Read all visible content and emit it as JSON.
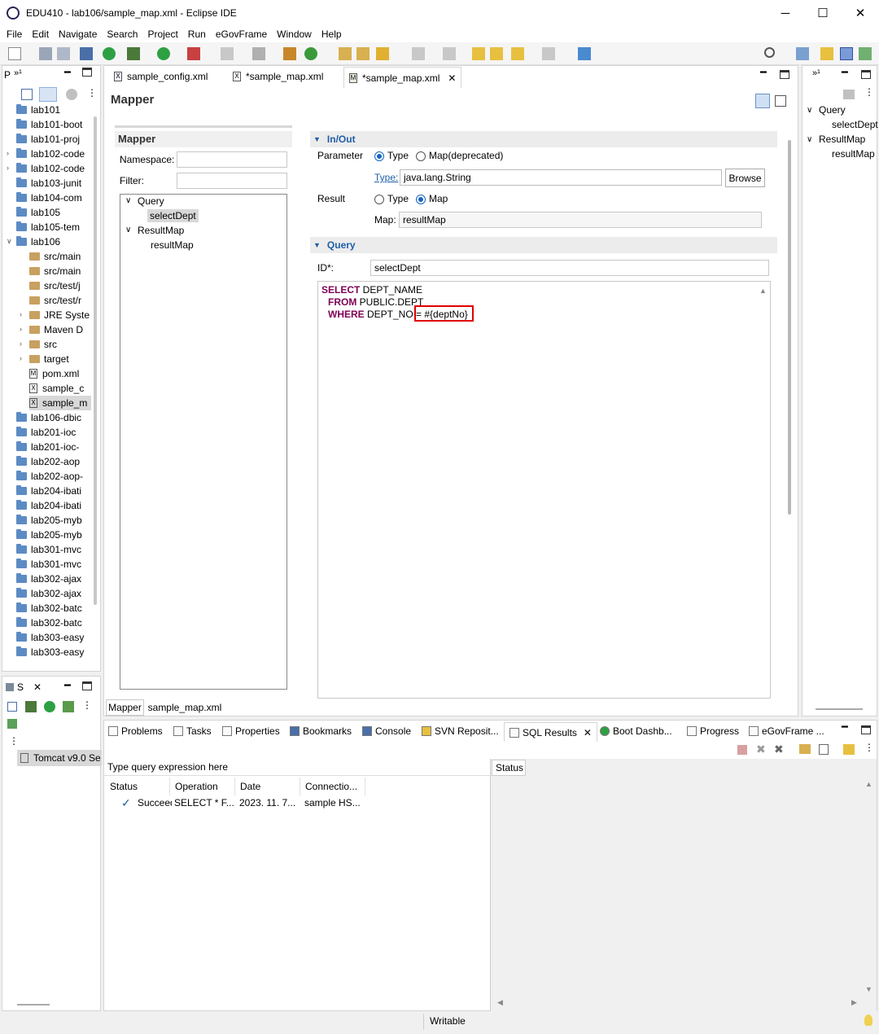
{
  "window": {
    "title": "EDU410 - lab106/sample_map.xml - Eclipse IDE",
    "minimize": "─",
    "maximize": "☐",
    "close": "✕"
  },
  "menu": [
    "File",
    "Edit",
    "Navigate",
    "Search",
    "Project",
    "Run",
    "eGovFrame",
    "Window",
    "Help"
  ],
  "explorer": {
    "tab": "P",
    "items": [
      "lab101",
      "lab101-boot",
      "lab101-proj",
      "lab102-code",
      "lab102-code",
      "lab103-junit",
      "lab104-com",
      "lab105",
      "lab105-tem",
      "lab106",
      "src/main",
      "src/main",
      "src/test/j",
      "src/test/r",
      "JRE Syste",
      "Maven D",
      "src",
      "target",
      "pom.xml",
      "sample_c",
      "sample_m",
      "lab106-dbic",
      "lab201-ioc",
      "lab201-ioc-",
      "lab202-aop",
      "lab202-aop-",
      "lab204-ibati",
      "lab204-ibati",
      "lab205-myb",
      "lab205-myb",
      "lab301-mvc",
      "lab301-mvc",
      "lab302-ajax",
      "lab302-ajax",
      "lab302-batc",
      "lab302-batc",
      "lab303-easy",
      "lab303-easy"
    ]
  },
  "servers": {
    "tab": "S",
    "item": "Tomcat v9.0 Se"
  },
  "editor_tabs": [
    "sample_config.xml",
    "*sample_map.xml",
    "*sample_map.xml"
  ],
  "mapper": {
    "title": "Mapper",
    "left_title": "Mapper",
    "namespace_label": "Namespace:",
    "namespace_value": "",
    "filter_label": "Filter:",
    "filter_value": "",
    "tree": {
      "query": "Query",
      "select": "selectDept",
      "resultmap": "ResultMap",
      "rm": "resultMap"
    },
    "inout": {
      "section": "In/Out",
      "parameter_label": "Parameter",
      "param_type": "Type",
      "param_map": "Map(deprecated)",
      "type_link": "Type:",
      "type_value": "java.lang.String",
      "browse": "Browse",
      "result_label": "Result",
      "result_type": "Type",
      "result_map": "Map",
      "map_label": "Map:",
      "map_value": "resultMap"
    },
    "query": {
      "section": "Query",
      "id_label": "ID*:",
      "id_value": "selectDept",
      "l1_kw": "SELECT",
      "l1_rest": " DEPT_NAME",
      "l2_kw": "FROM",
      "l2_rest": " PUBLIC.DEPT",
      "l3_kw": "WHERE",
      "l3_rest": " DEPT_NO = ",
      "l3_param": "#{deptNo}"
    },
    "bottom_tabs": [
      "Mapper",
      "sample_map.xml"
    ]
  },
  "outline": {
    "query": "Query",
    "select": "selectDept",
    "resultmap": "ResultMap",
    "rm": "resultMap"
  },
  "bottom_tabs": [
    "Problems",
    "Tasks",
    "Properties",
    "Bookmarks",
    "Console",
    "SVN Reposit...",
    "SQL Results",
    "Boot Dashb...",
    "Progress",
    "eGovFrame ..."
  ],
  "sql_results": {
    "query_placeholder": "Type query expression here",
    "columns": [
      "Status",
      "Operation",
      "Date",
      "Connectio..."
    ],
    "row": {
      "status": "Succeeded",
      "operation": "SELECT * F...",
      "date": "2023. 11. 7...",
      "connection": "sample HS..."
    },
    "status_tab": "Status"
  },
  "statusbar": {
    "writable": "Writable"
  }
}
